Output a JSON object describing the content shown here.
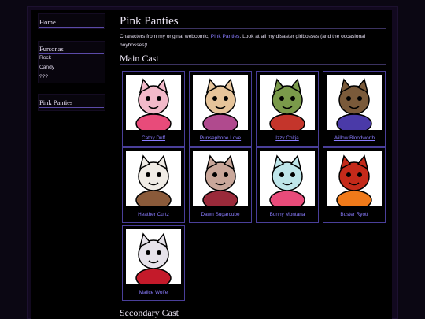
{
  "sidebar": {
    "home": "Home",
    "fursonas_heading": "Fursonas",
    "fursonas": [
      "Rock",
      "Candy",
      "???"
    ],
    "comic": "Pink Panties"
  },
  "main": {
    "title": "Pink Panties",
    "intro_prefix": "Characters from my original webcomic, ",
    "intro_link": "Pink Panties",
    "intro_suffix": ". Look at all my disaster girlbosses (and the occasional boybosses)!",
    "main_cast_heading": "Main Cast",
    "secondary_cast_heading": "Secondary Cast",
    "characters": [
      {
        "name": "Cathy Duff",
        "icon": "pink-pig-character-icon",
        "color": "#f2b9c9",
        "accent": "#e84b7a"
      },
      {
        "name": "Purrsephone Love",
        "icon": "cat-character-icon",
        "color": "#e6c49a",
        "accent": "#b04a8e"
      },
      {
        "name": "Izzy Coltja",
        "icon": "red-hair-character-icon",
        "color": "#7a9a4a",
        "accent": "#c4352b"
      },
      {
        "name": "Willow Bloodworth",
        "icon": "purple-hair-character-icon",
        "color": "#7a5a3a",
        "accent": "#4a3aa8"
      },
      {
        "name": "Heather Curtz",
        "icon": "mouse-character-icon",
        "color": "#f0ece6",
        "accent": "#8a5a3a"
      },
      {
        "name": "Dawn Sugarcube",
        "icon": "bunny-character-icon",
        "color": "#c9a79a",
        "accent": "#9a2a3a"
      },
      {
        "name": "Bunny Montana",
        "icon": "cyan-bunny-character-icon",
        "color": "#bfe6ea",
        "accent": "#e84b7a"
      },
      {
        "name": "Buster Ryott",
        "icon": "red-flame-character-icon",
        "color": "#c42a1a",
        "accent": "#f07a1a"
      },
      {
        "name": "Malice Wolfe",
        "icon": "wolf-character-icon",
        "color": "#e6e2ea",
        "accent": "#c41a2a"
      }
    ]
  }
}
